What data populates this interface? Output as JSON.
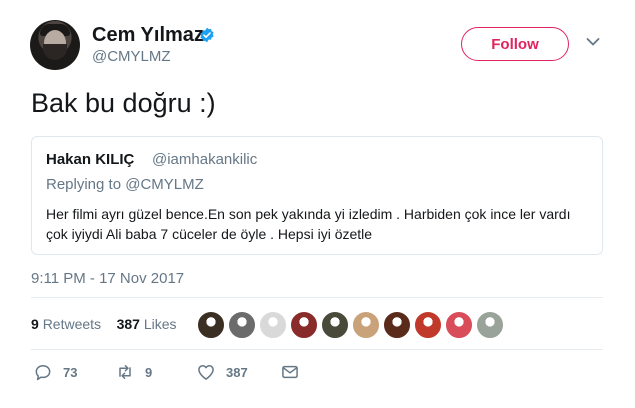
{
  "author": {
    "name": "Cem Yılmaz",
    "handle": "@CMYLMZ",
    "verified": true
  },
  "follow_label": "Follow",
  "tweet_text": "Bak bu doğru :)",
  "quoted": {
    "name": "Hakan KILIÇ",
    "handle": "@iamhakankilic",
    "replying_to": "Replying to @CMYLMZ",
    "text_line1": "Her filmi ayrı güzel bence.En son pek yakında yi izledim . Harbiden çok ince ler vardı",
    "text_line2": "çok iyiydi Ali baba 7 cüceler de öyle . Hepsi iyi özetle"
  },
  "timestamp": "9:11 PM - 17 Nov 2017",
  "stats": {
    "retweets_count": "9",
    "retweets_label": "Retweets",
    "likes_count": "387",
    "likes_label": "Likes"
  },
  "liker_avatar_colors": [
    "#3a2f22",
    "#6b6b6b",
    "#d9d9d9",
    "#8a2b2b",
    "#4a4a3a",
    "#c9a27a",
    "#5a2a1a",
    "#c0392b",
    "#d94c5a",
    "#9aa39a"
  ],
  "actions": {
    "reply_count": "73",
    "retweet_count": "9",
    "like_count": "387"
  },
  "colors": {
    "accent": "#e0245e",
    "verified": "#1da1f2",
    "secondary_text": "#657786"
  }
}
